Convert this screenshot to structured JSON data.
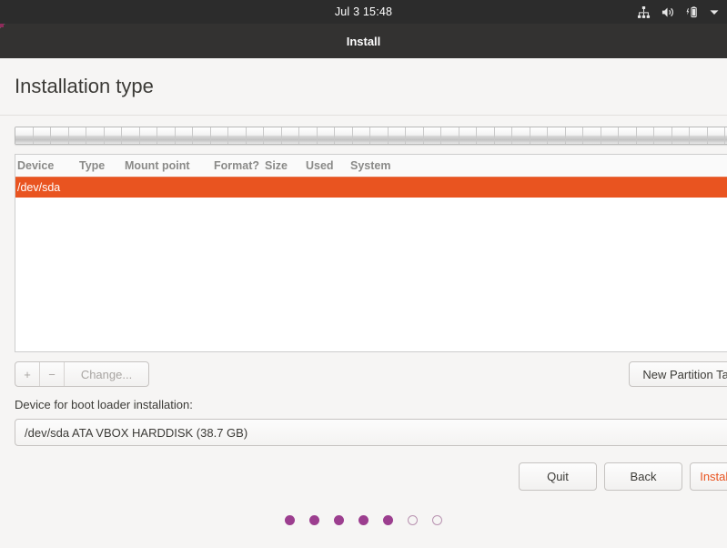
{
  "top_panel": {
    "clock": "Jul 3  15:48",
    "indicators": [
      {
        "icon": "network-icon",
        "name": "network"
      },
      {
        "icon": "volume-icon",
        "name": "volume"
      },
      {
        "icon": "battery-charging-icon",
        "name": "battery"
      },
      {
        "icon": "chevron-down-icon",
        "name": "session-menu"
      }
    ]
  },
  "window": {
    "title": "Install"
  },
  "page": {
    "title": "Installation type"
  },
  "disk_bar": {
    "segment_count": 41
  },
  "partition_table": {
    "columns": [
      "Device",
      "Type",
      "Mount point",
      "Format?",
      "Size",
      "Used",
      "System"
    ],
    "rows": [
      {
        "device": "/dev/sda",
        "type": "",
        "mount_point": "",
        "format": "",
        "size": "",
        "used": "",
        "system": "",
        "selected": true
      }
    ]
  },
  "toolbar": {
    "add_label": "+",
    "remove_label": "−",
    "change_label": "Change...",
    "new_partition_table_label": "New Partition Table..."
  },
  "bootloader": {
    "label": "Device for boot loader installation:",
    "selected": "/dev/sda ATA VBOX HARDDISK (38.7 GB)"
  },
  "actions": {
    "quit_label": "Quit",
    "back_label": "Back",
    "install_label": "Install Now"
  },
  "progress_dots": {
    "total": 7,
    "filled": 5
  },
  "colors": {
    "accent_orange": "#e95420",
    "panel_dark": "#2c2c2c",
    "titlebar_dark": "#333231",
    "dot_purple": "#9c3e8f",
    "background": "#f6f5f4"
  }
}
